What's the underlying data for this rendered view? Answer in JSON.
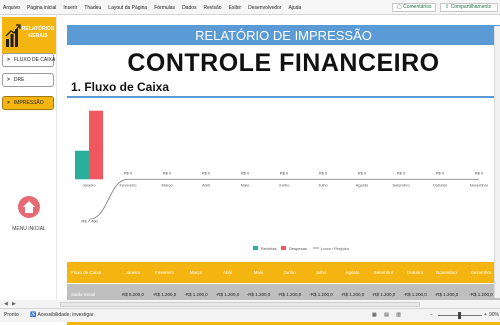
{
  "ribbon": {
    "menu": [
      "Arquivo",
      "Página inicial",
      "Inserir",
      "Thadeu",
      "Layout da Página",
      "Fórmulas",
      "Dados",
      "Revisão",
      "Exibir",
      "Desenvolvedor",
      "Ajuda"
    ],
    "comments_label": "Comentários",
    "share_label": "Compartilhamento"
  },
  "sidebar": {
    "logo_text": "RELATÓRIOS GERAIS",
    "items": [
      {
        "label": "FLUXO DE CAIXA",
        "active": false
      },
      {
        "label": "DRE",
        "active": false
      },
      {
        "label": "IMPRESSÃO",
        "active": true
      }
    ],
    "home_label": "MENU INICIAL"
  },
  "report": {
    "banner": "RELATÓRIO DE IMPRESSÃO",
    "title": "CONTROLE FINANCEIRO",
    "section": "1. Fluxo de Caixa"
  },
  "chart_data": {
    "type": "bar",
    "categories": [
      "Janeiro",
      "Fevereiro",
      "Março",
      "Abril",
      "Maio",
      "Junho",
      "Julho",
      "Agosto",
      "Setembro",
      "Outubro",
      "Novembro"
    ],
    "series": [
      {
        "name": "Receitas",
        "color": "#2ab09a",
        "values": [
          5,
          0,
          0,
          0,
          0,
          0,
          0,
          0,
          0,
          0,
          0
        ]
      },
      {
        "name": "Despesas",
        "color": "#f0575e",
        "values": [
          12,
          0,
          0,
          0,
          0,
          0,
          0,
          0,
          0,
          0,
          0
        ]
      },
      {
        "name": "Lucro / Prejuízo",
        "color": "#777777",
        "type": "line",
        "values": [
          -7,
          0,
          0,
          0,
          0,
          0,
          0,
          0,
          0,
          0,
          0
        ]
      }
    ],
    "data_labels": [
      "-R$ 7.400",
      "R$ 0",
      "R$ 0",
      "R$ 0",
      "R$ 0",
      "R$ 0",
      "R$ 0",
      "R$ 0",
      "R$ 0",
      "R$ 0",
      "R$ 0"
    ],
    "ylim": [
      -8,
      13
    ],
    "legend": "bottom"
  },
  "table": {
    "headers": [
      "Fluxo de Caixa",
      "Janeiro",
      "Fevereiro",
      "Março",
      "Abril",
      "Maio",
      "Junho",
      "Julho",
      "Agosto",
      "Setembro",
      "Outubro",
      "Novembro",
      "Dezembro"
    ],
    "row_label": "Saldo Inicial",
    "row_values": [
      "R$ 8.200,0",
      "-R$ 1.200,0",
      "-R$ 1.200,0",
      "-R$ 1.200,0",
      "-R$ 1.200,0",
      "-R$ 1.200,0",
      "-R$ 1.200,0",
      "-R$ 1.200,0",
      "-R$ 1.200,0",
      "-R$ 1.200,0",
      "-R$ 1.200,0",
      "-R$ 1.200,0"
    ]
  },
  "status": {
    "ready": "Pronto",
    "accessibility": "Acessibilidade: investigar",
    "zoom": "90%"
  }
}
